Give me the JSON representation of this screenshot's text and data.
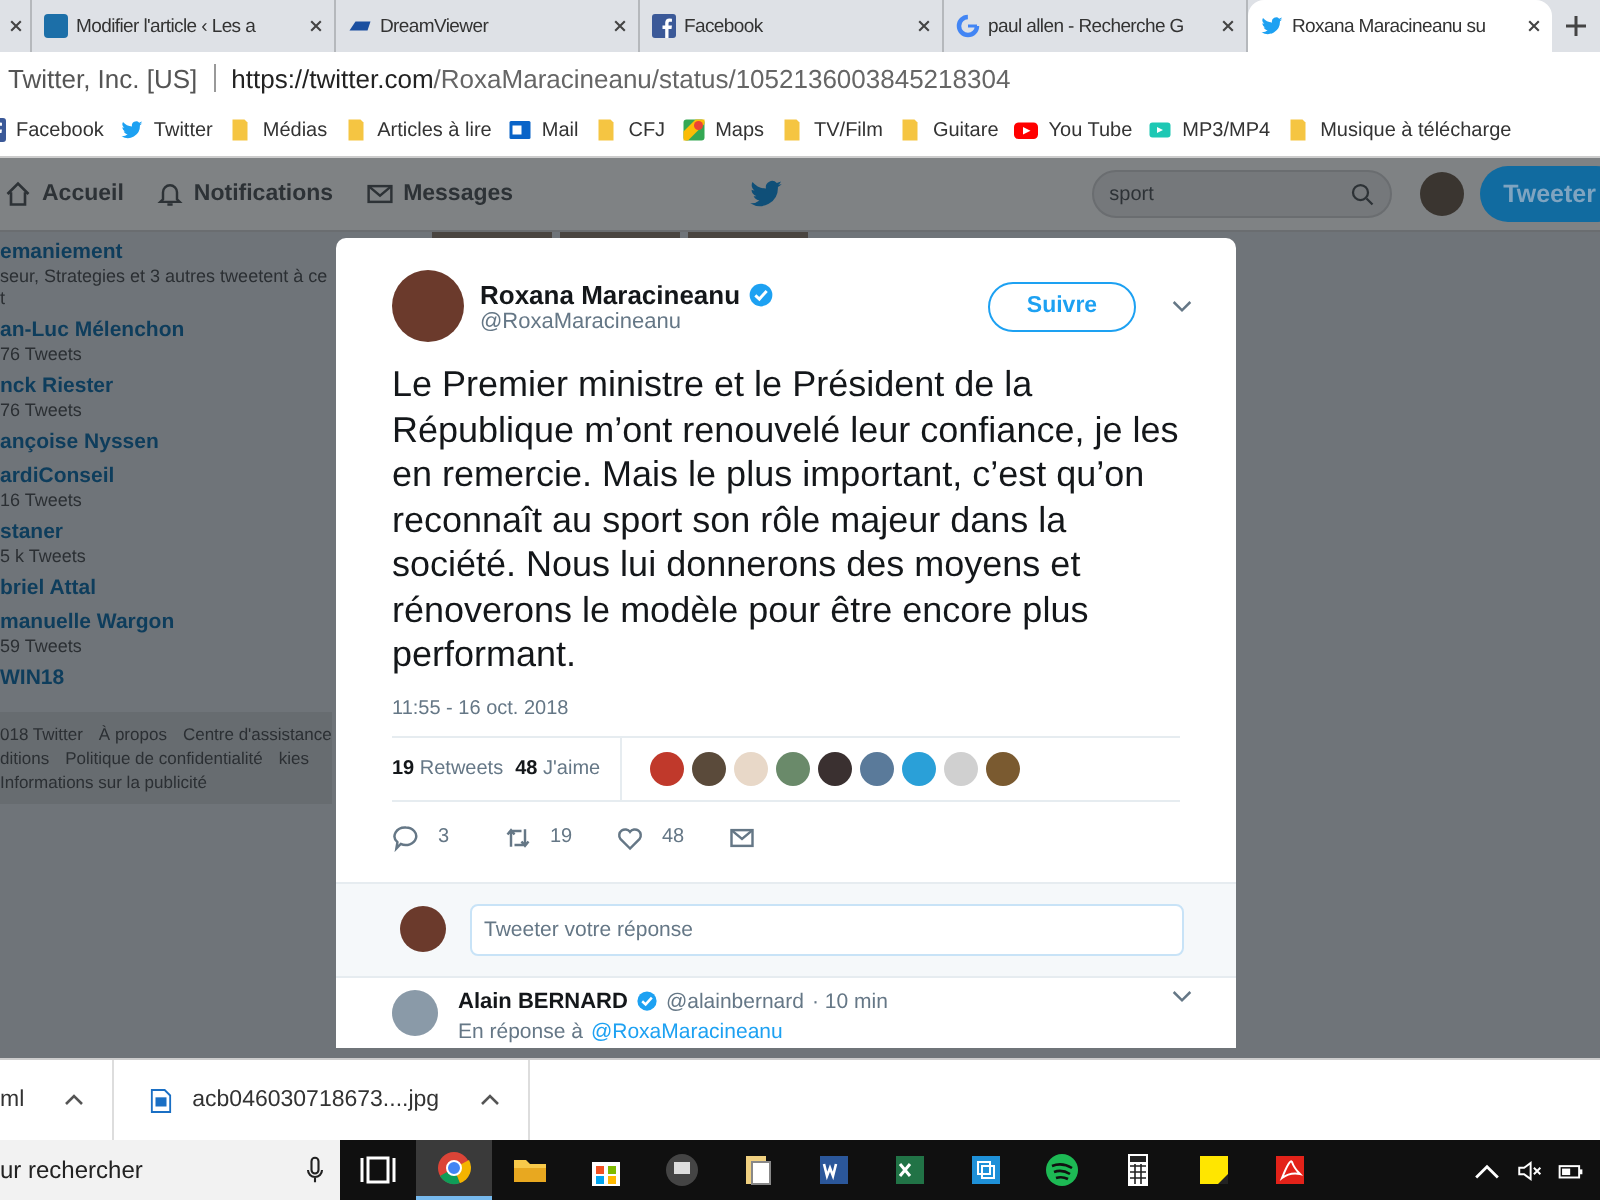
{
  "browser_tabs": [
    {
      "selected": false
    },
    {
      "title": "Modifier l'article ‹ Les a",
      "kind": "cfj",
      "selected": false
    },
    {
      "title": "DreamViewer",
      "kind": "afp",
      "selected": false
    },
    {
      "title": "Facebook",
      "kind": "facebook",
      "selected": false
    },
    {
      "title": "paul allen - Recherche G",
      "kind": "google",
      "selected": false
    },
    {
      "title": "Roxana Maracineanu su",
      "kind": "twitter",
      "selected": true
    }
  ],
  "address_bar": {
    "site_identity": "Twitter, Inc. [US]",
    "url_host": "https://twitter.com",
    "url_path": "/RoxaMaracineanu/status/1052136003845218304"
  },
  "bookmarks": [
    {
      "label": "Facebook",
      "kind": "facebook"
    },
    {
      "label": "Twitter",
      "kind": "twitter"
    },
    {
      "label": "Médias",
      "kind": "folder"
    },
    {
      "label": "Articles à lire",
      "kind": "folder"
    },
    {
      "label": "Mail",
      "kind": "mail"
    },
    {
      "label": "CFJ",
      "kind": "folder"
    },
    {
      "label": "Maps",
      "kind": "maps"
    },
    {
      "label": "TV/Film",
      "kind": "folder"
    },
    {
      "label": "Guitare",
      "kind": "folder"
    },
    {
      "label": "You Tube",
      "kind": "youtube"
    },
    {
      "label": "MP3/MP4",
      "kind": "media"
    },
    {
      "label": "Musique à télécharge",
      "kind": "folder"
    }
  ],
  "twitter_nav": {
    "items": [
      {
        "label": "Accueil",
        "kind": "home"
      },
      {
        "label": "Notifications",
        "kind": "bell"
      },
      {
        "label": "Messages",
        "kind": "mail"
      }
    ],
    "search": "sport",
    "tweet_button": "Tweeter"
  },
  "trends": [
    {
      "name": "emaniement",
      "detail": "seur, Strategies et 3 autres tweetent à ce t"
    },
    {
      "name": "an-Luc Mélenchon",
      "detail": "76 Tweets"
    },
    {
      "name": "nck Riester",
      "detail": "76 Tweets"
    },
    {
      "name": "ançoise Nyssen"
    },
    {
      "name": "ardiConseil",
      "detail": "16 Tweets"
    },
    {
      "name": "staner",
      "detail": "5 k Tweets"
    },
    {
      "name": "briel Attal"
    },
    {
      "name": "manuelle Wargon",
      "detail": "59 Tweets"
    },
    {
      "name": "WIN18"
    }
  ],
  "footer_links": [
    "018 Twitter",
    "À propos",
    "Centre d'assistance",
    "ditions",
    "Politique de confidentialité",
    "kies",
    "Informations sur la publicité"
  ],
  "tweet": {
    "author": "Roxana Maracineanu",
    "verified": true,
    "handle": "@RoxaMaracineanu",
    "follow_button": "Suivre",
    "text": "Le Premier ministre et le Président de la République m’ont renouvelé leur confiance, je les en remercie. Mais le plus important, c’est qu’on reconnaît au sport son rôle majeur dans la société. Nous lui donnerons des moyens et rénoverons le modèle pour être encore plus performant.",
    "time": "11:55 - 16 oct. 2018",
    "stats": [
      {
        "count": "19",
        "label": "Retweets"
      },
      {
        "count": "48",
        "label": "J'aime"
      }
    ],
    "actions": [
      {
        "kind": "reply",
        "count": "3"
      },
      {
        "kind": "retweet",
        "count": "19"
      },
      {
        "kind": "like",
        "count": "48"
      },
      {
        "kind": "message"
      }
    ],
    "reply_placeholder": "Tweeter votre réponse",
    "reply": {
      "author": "Alain BERNARD",
      "verified": true,
      "handle": "@alainbernard",
      "time": "· 10 min",
      "in_reply_to": "En réponse à",
      "mention": "@RoxaMaracineanu"
    }
  },
  "downloads": [
    "ml",
    "acb046030718673....jpg"
  ],
  "taskbar": {
    "search": "ur rechercher",
    "apps": [
      {
        "kind": "taskview",
        "selected": false
      },
      {
        "kind": "chrome",
        "selected": true
      },
      {
        "kind": "explorer",
        "selected": false
      },
      {
        "kind": "store",
        "selected": false
      },
      {
        "kind": "monitor",
        "selected": false
      },
      {
        "kind": "files",
        "selected": false
      },
      {
        "kind": "word",
        "selected": false
      },
      {
        "kind": "excel",
        "selected": false
      },
      {
        "kind": "remote",
        "selected": false
      },
      {
        "kind": "spotify",
        "selected": false
      },
      {
        "kind": "calculator",
        "selected": false
      },
      {
        "kind": "sticky",
        "selected": false
      },
      {
        "kind": "acrobat",
        "selected": false
      }
    ]
  }
}
